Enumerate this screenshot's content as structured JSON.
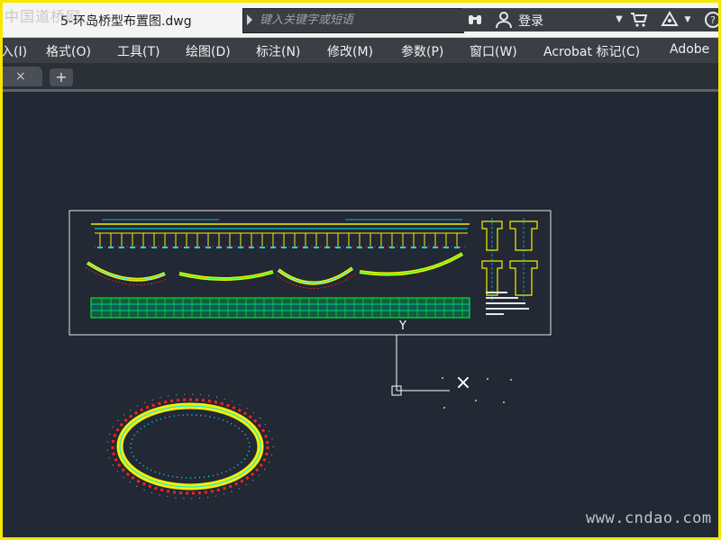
{
  "window": {
    "file_title": "5-环岛桥型布置图.dwg",
    "watermark_top": "中国道桥网",
    "watermark_bottom": "www.cndao.com"
  },
  "search": {
    "placeholder": "键入关键字或短语"
  },
  "toolbar": {
    "login_label": "登录",
    "icons": [
      "binoculars-icon",
      "user-icon",
      "dropdown-icon",
      "cart-icon",
      "warning-icon",
      "help-icon"
    ]
  },
  "menu": {
    "items": [
      {
        "label": "入(I)"
      },
      {
        "label": "格式(O)"
      },
      {
        "label": "工具(T)"
      },
      {
        "label": "绘图(D)"
      },
      {
        "label": "标注(N)"
      },
      {
        "label": "修改(M)"
      },
      {
        "label": "参数(P)"
      },
      {
        "label": "窗口(W)"
      },
      {
        "label": "Acrobat 标记(C)"
      },
      {
        "label": "Adobe"
      }
    ]
  },
  "tabs": {
    "close_symbol": "×",
    "new_symbol": "+"
  },
  "colors": {
    "canvas_bg": "#222834",
    "frame_border": "#f5e700",
    "ucs": "#ffffff",
    "drawing_yellow": "#f4f000",
    "drawing_cyan": "#00e5ff",
    "drawing_green": "#00ff40",
    "drawing_red": "#ff2020"
  },
  "canvas": {
    "ucs_y_label": "Y",
    "crosshair_symbol": "×"
  }
}
